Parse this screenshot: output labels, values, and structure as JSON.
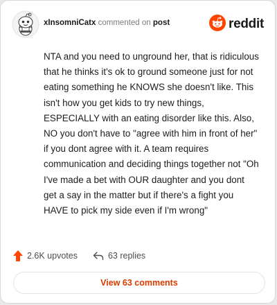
{
  "header": {
    "username": "xInsomniCatx",
    "action_text": " commented on ",
    "target_text": "post",
    "logo_wordmark": "reddit",
    "avatar_icon": "snoo-avatar-icon",
    "logo_icon": "reddit-alien-icon"
  },
  "comment": {
    "body": "NTA and you need to unground her, that is ridiculous that he thinks it's ok to ground someone just for not eating something he KNOWS she doesn't like. This isn't how you get kids to try new things, ESPECIALLY with an eating disorder like this. Also, NO you don't have to \"agree with him in front of her\" if you dont agree with it. A team requires communication and deciding things together not \"Oh I've made a bet with OUR daughter and you dont get a say in the matter but if there's a fight you HAVE to pick my side even if I'm wrong\""
  },
  "footer": {
    "upvotes_label": "2.6K upvotes",
    "replies_label": "63 replies",
    "upvote_icon": "upvote-arrow-icon",
    "reply_icon": "reply-arrow-icon"
  },
  "view_button": {
    "label": "View 63 comments"
  },
  "colors": {
    "accent": "#d93a00",
    "upvote": "#ff4500",
    "logo": "#ff4500",
    "text": "#1c1c1c",
    "muted": "#7c7c7c"
  }
}
